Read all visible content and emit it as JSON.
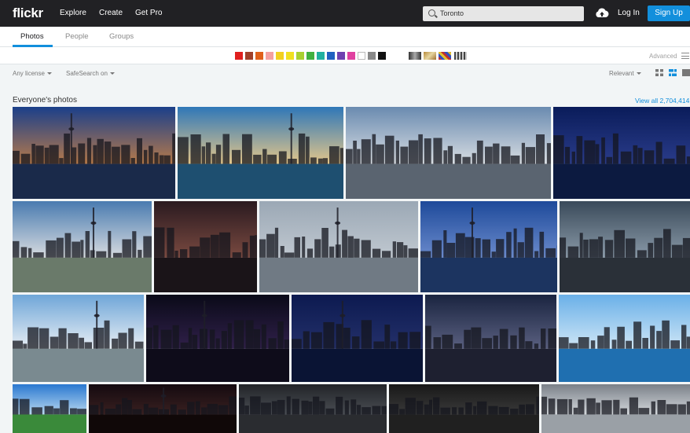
{
  "header": {
    "logo": "flickr",
    "nav": [
      "Explore",
      "Create",
      "Get Pro"
    ],
    "search_value": "Toronto",
    "login": "Log In",
    "signup": "Sign Up"
  },
  "tabs": [
    "Photos",
    "People",
    "Groups"
  ],
  "color_filters": [
    "#e0201f",
    "#a0402a",
    "#e0601a",
    "#f4a0a0",
    "#f2d020",
    "#f0e020",
    "#a8d030",
    "#40b040",
    "#20b0a0",
    "#2060c0",
    "#7040b0",
    "#e040a0",
    "#ffffff",
    "#888888",
    "#111111"
  ],
  "advanced_label": "Advanced",
  "filters": {
    "license": "Any license",
    "safesearch": "SafeSearch on",
    "sort": "Relevant"
  },
  "section": {
    "title": "Everyone's photos",
    "view_all": "View all 2,704,414"
  },
  "photos": [
    {
      "name": "skyline-night-1",
      "sky_top": "#1b3f8a",
      "sky_bottom": "#b77a4a",
      "water": "#1a2a4a",
      "tower": true
    },
    {
      "name": "skyline-day-tower",
      "sky_top": "#2f77b8",
      "sky_bottom": "#e3c68a",
      "water": "#1e4f70",
      "tower": true
    },
    {
      "name": "city-hall",
      "sky_top": "#6a8bb0",
      "sky_bottom": "#d8dde2",
      "water": "#5a6470",
      "tower": false
    },
    {
      "name": "skyline-night-blue",
      "sky_top": "#0a1c5a",
      "sky_bottom": "#2a3c8a",
      "water": "#0c1a40",
      "tower": false
    },
    {
      "name": "skyline-clouds-condos",
      "sky_top": "#4a7bb0",
      "sky_bottom": "#d8dce0",
      "water": "#6a7a6a",
      "tower": true
    },
    {
      "name": "aerial-night-lights",
      "sky_top": "#2a1a20",
      "sky_bottom": "#7a4a40",
      "water": "#1a1418",
      "tower": false
    },
    {
      "name": "skyline-grey-day",
      "sky_top": "#9ba8b5",
      "sky_bottom": "#c0c8d0",
      "water": "#707a84",
      "tower": true
    },
    {
      "name": "skyline-blue-dusk",
      "sky_top": "#1e4a9a",
      "sky_bottom": "#6a8acc",
      "water": "#1c3460",
      "tower": true
    },
    {
      "name": "glass-building",
      "sky_top": "#3a4a5a",
      "sky_bottom": "#8a9aa8",
      "water": "#2a3038",
      "tower": false
    },
    {
      "name": "skyline-reflection-park",
      "sky_top": "#6fa6d8",
      "sky_bottom": "#e8eef4",
      "water": "#7a8a90",
      "tower": true
    },
    {
      "name": "skyline-night-purple",
      "sky_top": "#0a0a18",
      "sky_bottom": "#30204a",
      "water": "#0e0c1a",
      "tower": true
    },
    {
      "name": "skyline-night-harbour",
      "sky_top": "#0c1a50",
      "sky_bottom": "#24306a",
      "water": "#0a1434",
      "tower": true
    },
    {
      "name": "aerial-city-dusk",
      "sky_top": "#1a2440",
      "sky_bottom": "#5a6080",
      "water": "#1e2030",
      "tower": false
    },
    {
      "name": "rocky-shore",
      "sky_top": "#6ab0e8",
      "sky_bottom": "#cfe6f6",
      "water": "#1f6fb0",
      "tower": false
    },
    {
      "name": "green-hills-sky",
      "sky_top": "#2a78d0",
      "sky_bottom": "#b8d8f0",
      "water": "#3a8a3a",
      "tower": false
    },
    {
      "name": "night-tower-purple",
      "sky_top": "#140a10",
      "sky_bottom": "#3a2020",
      "water": "#100808",
      "tower": true
    },
    {
      "name": "dark-building-rain",
      "sky_top": "#222428",
      "sky_bottom": "#4a4e54",
      "water": "#2a2c30",
      "tower": false
    },
    {
      "name": "window-city-night",
      "sky_top": "#181818",
      "sky_bottom": "#3a3a3a",
      "water": "#202020",
      "tower": false
    },
    {
      "name": "cloudy-sky",
      "sky_top": "#7a8088",
      "sky_bottom": "#d4d8dc",
      "water": "#9aa0a6",
      "tower": false
    }
  ]
}
